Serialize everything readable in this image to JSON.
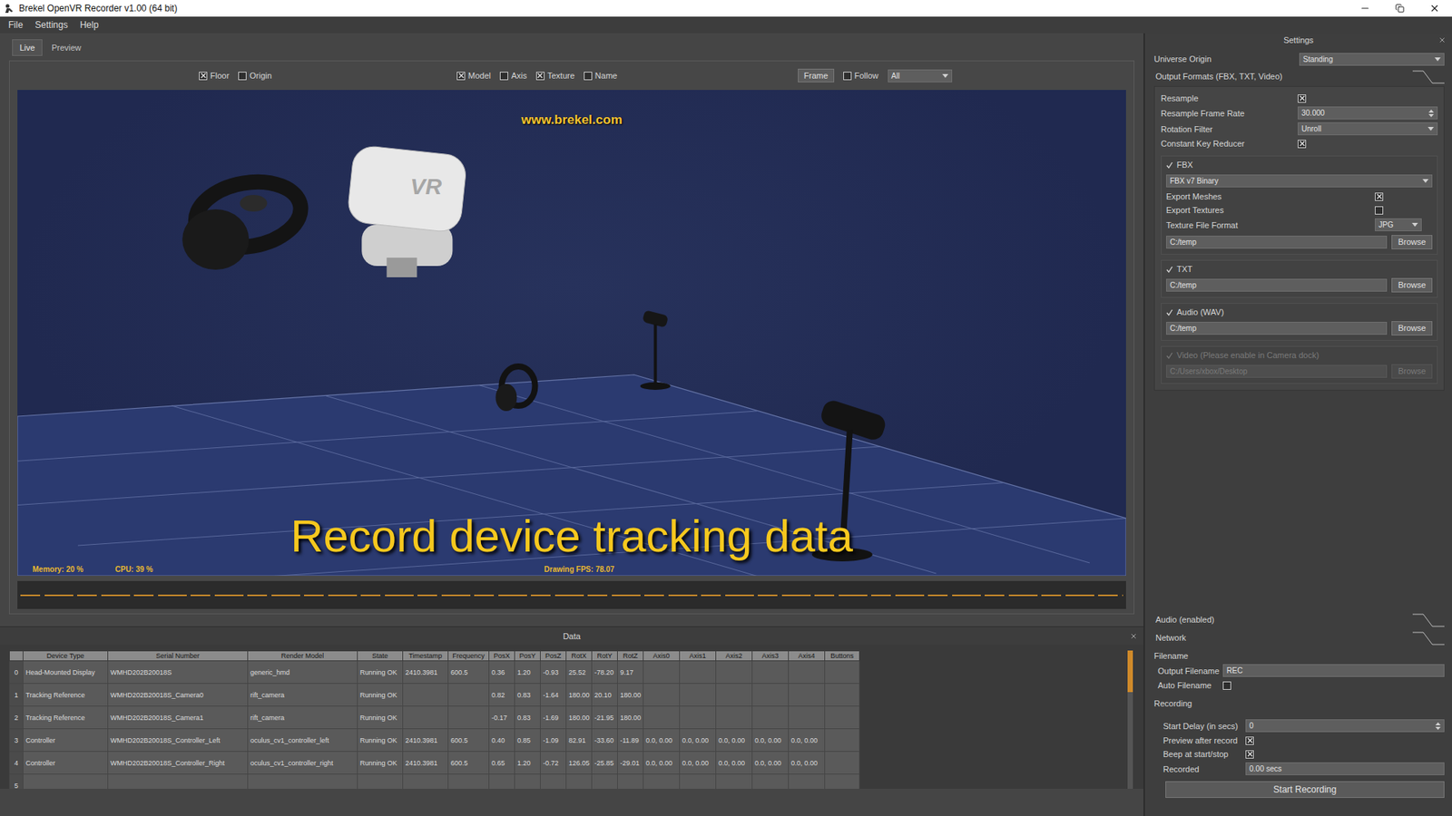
{
  "window": {
    "title": "Brekel OpenVR Recorder v1.00 (64 bit)"
  },
  "menu": [
    "File",
    "Settings",
    "Help"
  ],
  "view_tabs": [
    {
      "label": "Live",
      "selected": true
    },
    {
      "label": "Preview",
      "selected": false
    }
  ],
  "toolbar": {
    "groups": [
      {
        "items": [
          {
            "kind": "check",
            "label": "Floor",
            "checked": true
          },
          {
            "kind": "check",
            "label": "Origin",
            "checked": false
          }
        ]
      },
      {
        "items": [
          {
            "kind": "check",
            "label": "Model",
            "checked": true
          },
          {
            "kind": "check",
            "label": "Axis",
            "checked": false
          },
          {
            "kind": "check",
            "label": "Texture",
            "checked": true
          },
          {
            "kind": "check",
            "label": "Name",
            "checked": false
          }
        ]
      },
      {
        "items": [
          {
            "kind": "button",
            "label": "Frame"
          },
          {
            "kind": "check",
            "label": "Follow",
            "checked": false
          },
          {
            "kind": "select",
            "label": "All"
          }
        ]
      }
    ]
  },
  "viewport": {
    "watermark": "www.brekel.com",
    "caption": "Record device tracking data",
    "headset_label": "VR",
    "stats_left": [
      "Memory: 20 %",
      "CPU: 39 %"
    ],
    "stats_center": "Drawing FPS: 78.07"
  },
  "data_panel": {
    "title": "Data",
    "scroll_level": 0.3,
    "columns": [
      "",
      "Device Type",
      "Serial Number",
      "Render Model",
      "State",
      "Timestamp",
      "Frequency",
      "PosX",
      "PosY",
      "PosZ",
      "RotX",
      "RotY",
      "RotZ",
      "Axis0",
      "Axis1",
      "Axis2",
      "Axis3",
      "Axis4",
      "Buttons"
    ],
    "rows": [
      {
        "index": "0",
        "cells": [
          "Head-Mounted Display",
          "WMHD202B20018S",
          "generic_hmd",
          "Running OK",
          "2410.3981",
          "600.5",
          "0.36",
          "1.20",
          "-0.93",
          "25.52",
          "-78.20",
          "9.17",
          "",
          "",
          "",
          "",
          "",
          ""
        ]
      },
      {
        "index": "1",
        "cells": [
          "Tracking Reference",
          "WMHD202B20018S_Camera0",
          "rift_camera",
          "Running OK",
          "",
          "",
          "0.82",
          "0.83",
          "-1.64",
          "180.00",
          "20.10",
          "180.00",
          "",
          "",
          "",
          "",
          "",
          ""
        ]
      },
      {
        "index": "2",
        "cells": [
          "Tracking Reference",
          "WMHD202B20018S_Camera1",
          "rift_camera",
          "Running OK",
          "",
          "",
          "-0.17",
          "0.83",
          "-1.69",
          "180.00",
          "-21.95",
          "180.00",
          "",
          "",
          "",
          "",
          "",
          ""
        ]
      },
      {
        "index": "3",
        "cells": [
          "Controller",
          "WMHD202B20018S_Controller_Left",
          "oculus_cv1_controller_left",
          "Running OK",
          "2410.3981",
          "600.5",
          "0.40",
          "0.85",
          "-1.09",
          "82.91",
          "-33.60",
          "-11.89",
          "0.0, 0.00",
          "0.0, 0.00",
          "0.0, 0.00",
          "0.0, 0.00",
          "0.0, 0.00",
          ""
        ]
      },
      {
        "index": "4",
        "cells": [
          "Controller",
          "WMHD202B20018S_Controller_Right",
          "oculus_cv1_controller_right",
          "Running OK",
          "2410.3981",
          "600.5",
          "0.65",
          "1.20",
          "-0.72",
          "126.05",
          "-25.85",
          "-29.01",
          "0.0, 0.00",
          "0.0, 0.00",
          "0.0, 0.00",
          "0.0, 0.00",
          "0.0, 0.00",
          ""
        ]
      },
      {
        "index": "5",
        "cells": []
      }
    ]
  },
  "settings": {
    "title": "Settings",
    "universe_origin": {
      "label": "Universe Origin",
      "value": "Standing"
    },
    "output_formats": {
      "title": "Output Formats (FBX, TXT, Video)",
      "expanded": true,
      "rows": [
        {
          "kind": "check",
          "label": "Resample",
          "checked": true
        },
        {
          "kind": "spin",
          "label": "Resample Frame Rate",
          "value": "30.000"
        },
        {
          "kind": "select",
          "label": "Rotation Filter",
          "value": "Unroll"
        },
        {
          "kind": "check",
          "label": "Constant Key Reducer",
          "checked": true
        }
      ],
      "groups": [
        {
          "label": "FBX",
          "checked": true,
          "disabled": false,
          "rows": [
            {
              "kind": "select",
              "label": "",
              "value": "FBX v7 Binary"
            },
            {
              "kind": "check",
              "label": "Export Meshes",
              "checked": true
            },
            {
              "kind": "check",
              "label": "Export Textures",
              "checked": false
            },
            {
              "kind": "select",
              "label": "Texture File Format",
              "value": "JPG"
            },
            {
              "kind": "path",
              "value": "C:/temp",
              "button": "Browse"
            }
          ]
        },
        {
          "label": "TXT",
          "checked": true,
          "disabled": false,
          "rows": [
            {
              "kind": "path",
              "value": "C:/temp",
              "button": "Browse"
            }
          ]
        },
        {
          "label": "Audio (WAV)",
          "checked": true,
          "disabled": false,
          "rows": [
            {
              "kind": "path",
              "value": "C:/temp",
              "button": "Browse"
            }
          ]
        },
        {
          "label": "Video (Please enable in Camera dock)",
          "checked": true,
          "disabled": true,
          "rows": [
            {
              "kind": "path",
              "value": "C:/Users/xbox/Desktop",
              "button": "Browse"
            }
          ]
        }
      ]
    },
    "collapsed_sections": [
      {
        "title": "Audio (enabled)",
        "expanded": false
      },
      {
        "title": "Network",
        "expanded": false
      }
    ],
    "filename": {
      "title": "Filename",
      "rows": [
        {
          "kind": "text",
          "label": "Output Filename",
          "value": "REC"
        },
        {
          "kind": "check",
          "label": "Auto Filename",
          "checked": false
        }
      ]
    },
    "recording": {
      "title": "Recording",
      "rows": [
        {
          "kind": "spin",
          "label": "Start Delay (in secs)",
          "value": "0"
        },
        {
          "kind": "check",
          "label": "Preview after record",
          "checked": true
        },
        {
          "kind": "check",
          "label": "Beep at start/stop",
          "checked": true
        },
        {
          "kind": "readout",
          "label": "Recorded",
          "value": "0.00 secs"
        }
      ],
      "button": "Start Recording"
    }
  }
}
